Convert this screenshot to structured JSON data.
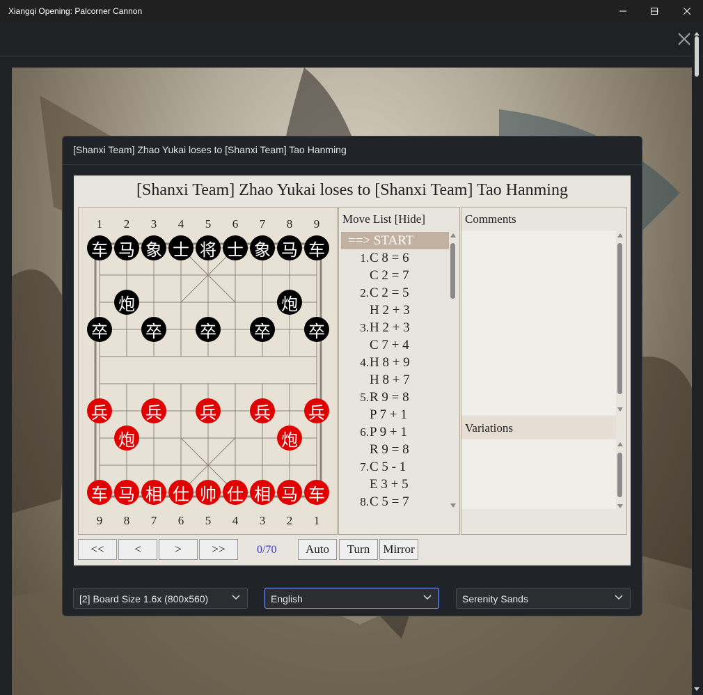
{
  "window": {
    "title": "Xiangqi Opening: Palcorner Cannon"
  },
  "dialog": {
    "title": "[Shanxi Team] Zhao Yukai loses to [Shanxi Team] Tao Hanming"
  },
  "game": {
    "title": "[Shanxi Team] Zhao Yukai loses to [Shanxi Team] Tao Hanming"
  },
  "board": {
    "top_files": [
      "1",
      "2",
      "3",
      "4",
      "5",
      "6",
      "7",
      "8",
      "9"
    ],
    "bottom_files": [
      "9",
      "8",
      "7",
      "6",
      "5",
      "4",
      "3",
      "2",
      "1"
    ],
    "pieces": [
      {
        "side": "black",
        "char": "车",
        "file": 0,
        "rank": 0
      },
      {
        "side": "black",
        "char": "马",
        "file": 1,
        "rank": 0
      },
      {
        "side": "black",
        "char": "象",
        "file": 2,
        "rank": 0
      },
      {
        "side": "black",
        "char": "士",
        "file": 3,
        "rank": 0
      },
      {
        "side": "black",
        "char": "将",
        "file": 4,
        "rank": 0
      },
      {
        "side": "black",
        "char": "士",
        "file": 5,
        "rank": 0
      },
      {
        "side": "black",
        "char": "象",
        "file": 6,
        "rank": 0
      },
      {
        "side": "black",
        "char": "马",
        "file": 7,
        "rank": 0
      },
      {
        "side": "black",
        "char": "车",
        "file": 8,
        "rank": 0
      },
      {
        "side": "black",
        "char": "炮",
        "file": 1,
        "rank": 2
      },
      {
        "side": "black",
        "char": "炮",
        "file": 7,
        "rank": 2
      },
      {
        "side": "black",
        "char": "卒",
        "file": 0,
        "rank": 3
      },
      {
        "side": "black",
        "char": "卒",
        "file": 2,
        "rank": 3
      },
      {
        "side": "black",
        "char": "卒",
        "file": 4,
        "rank": 3
      },
      {
        "side": "black",
        "char": "卒",
        "file": 6,
        "rank": 3
      },
      {
        "side": "black",
        "char": "卒",
        "file": 8,
        "rank": 3
      },
      {
        "side": "red",
        "char": "兵",
        "file": 0,
        "rank": 6
      },
      {
        "side": "red",
        "char": "兵",
        "file": 2,
        "rank": 6
      },
      {
        "side": "red",
        "char": "兵",
        "file": 4,
        "rank": 6
      },
      {
        "side": "red",
        "char": "兵",
        "file": 6,
        "rank": 6
      },
      {
        "side": "red",
        "char": "兵",
        "file": 8,
        "rank": 6
      },
      {
        "side": "red",
        "char": "炮",
        "file": 1,
        "rank": 7
      },
      {
        "side": "red",
        "char": "炮",
        "file": 7,
        "rank": 7
      },
      {
        "side": "red",
        "char": "车",
        "file": 0,
        "rank": 9
      },
      {
        "side": "red",
        "char": "马",
        "file": 1,
        "rank": 9
      },
      {
        "side": "red",
        "char": "相",
        "file": 2,
        "rank": 9
      },
      {
        "side": "red",
        "char": "仕",
        "file": 3,
        "rank": 9
      },
      {
        "side": "red",
        "char": "帅",
        "file": 4,
        "rank": 9
      },
      {
        "side": "red",
        "char": "仕",
        "file": 5,
        "rank": 9
      },
      {
        "side": "red",
        "char": "相",
        "file": 6,
        "rank": 9
      },
      {
        "side": "red",
        "char": "马",
        "file": 7,
        "rank": 9
      },
      {
        "side": "red",
        "char": "车",
        "file": 8,
        "rank": 9
      }
    ]
  },
  "moves": {
    "header": "Move List [Hide]",
    "start_label": "==> START",
    "rows": [
      {
        "num": "1.",
        "text": "C 8 = 6"
      },
      {
        "num": "",
        "text": "C 2 = 7"
      },
      {
        "num": "2.",
        "text": "C 2 = 5"
      },
      {
        "num": "",
        "text": "H 2 + 3"
      },
      {
        "num": "3.",
        "text": "H 2 + 3"
      },
      {
        "num": "",
        "text": "C 7 + 4"
      },
      {
        "num": "4.",
        "text": "H 8 + 9"
      },
      {
        "num": "",
        "text": "H 8 + 7"
      },
      {
        "num": "5.",
        "text": "R 9 = 8"
      },
      {
        "num": "",
        "text": "P 7 + 1"
      },
      {
        "num": "6.",
        "text": "P 9 + 1"
      },
      {
        "num": "",
        "text": "R 9 = 8"
      },
      {
        "num": "7.",
        "text": "C 5 - 1"
      },
      {
        "num": "",
        "text": "E 3 + 5"
      },
      {
        "num": "8.",
        "text": "C 5 = 7"
      }
    ]
  },
  "comments": {
    "header": "Comments"
  },
  "variations": {
    "header": "Variations"
  },
  "controls": {
    "first": "<<",
    "prev": "<",
    "next": ">",
    "last": ">>",
    "counter": "0/70",
    "auto": "Auto",
    "turn": "Turn",
    "mirror": "Mirror"
  },
  "selects": {
    "board_size": "[2] Board Size 1.6x (800x560)",
    "language": "English",
    "theme": "Serenity Sands"
  }
}
